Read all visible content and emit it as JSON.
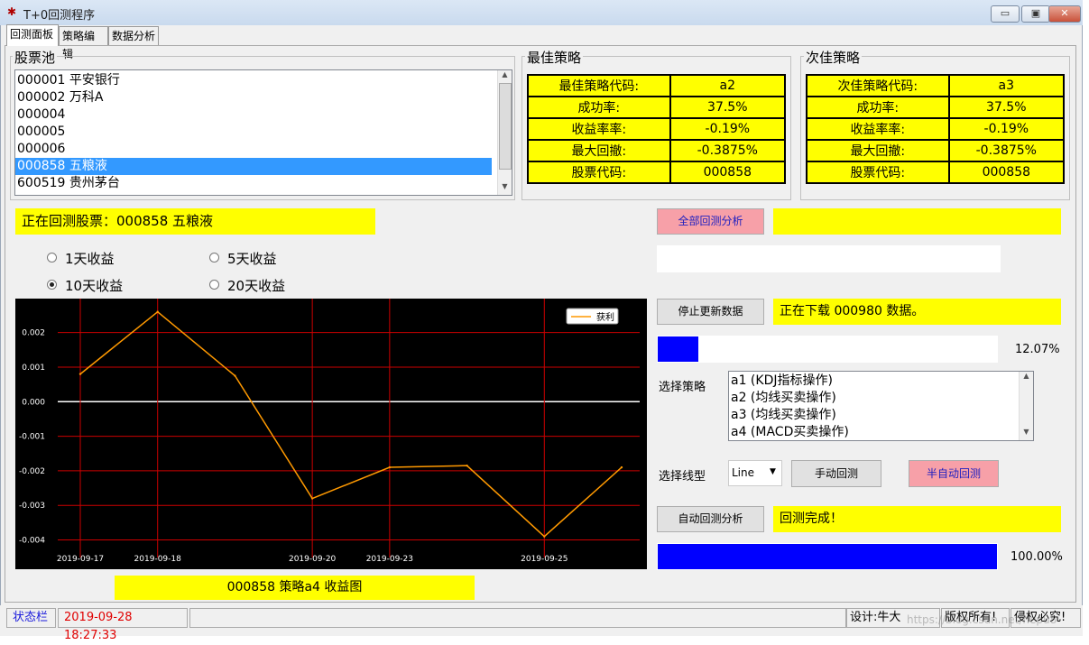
{
  "window": {
    "title": "T+0回测程序",
    "minimize": "▭",
    "maximize": "▣",
    "close": "✕"
  },
  "tabs": [
    "回测面板",
    "策略编辑",
    "数据分析"
  ],
  "stock_pool": {
    "label": "股票池",
    "items": [
      "000001 平安银行",
      "000002 万科A",
      "000004",
      "000005",
      "000006",
      "000858 五粮液",
      "600519 贵州茅台"
    ],
    "selected_index": 5
  },
  "best": {
    "label": "最佳策略",
    "rows": [
      [
        "最佳策略代码:",
        "a2"
      ],
      [
        "成功率:",
        "37.5%"
      ],
      [
        "收益率率:",
        "-0.19%"
      ],
      [
        "最大回撤:",
        "-0.3875%"
      ],
      [
        "股票代码:",
        "000858"
      ]
    ]
  },
  "second": {
    "label": "次佳策略",
    "rows": [
      [
        "次佳策略代码:",
        "a3"
      ],
      [
        "成功率:",
        "37.5%"
      ],
      [
        "收益率率:",
        "-0.19%"
      ],
      [
        "最大回撤:",
        "-0.3875%"
      ],
      [
        "股票代码:",
        "000858"
      ]
    ]
  },
  "current_stock": "正在回测股票：000858 五粮液",
  "horizons": {
    "options": [
      "1天收益",
      "5天收益",
      "10天收益",
      "20天收益"
    ],
    "selected": "10天收益"
  },
  "chart_data": {
    "type": "line",
    "x": [
      "2019-09-17",
      "2019-09-18",
      "2019-09-19",
      "2019-09-20",
      "2019-09-23",
      "2019-09-24",
      "2019-09-25",
      "2019-09-26"
    ],
    "series": [
      {
        "name": "获利",
        "values": [
          0.0008,
          0.0026,
          0.00075,
          -0.0028,
          -0.0019,
          -0.00185,
          -0.0039,
          -0.0019
        ],
        "color": "#ff9900"
      }
    ],
    "x_tick_labels": [
      "2019-09-17",
      "2019-09-18",
      "2019-09-20",
      "2019-09-23",
      "2019-09-25"
    ],
    "y_ticks": [
      0.002,
      0.001,
      0.0,
      -0.001,
      -0.002,
      -0.003,
      -0.004
    ],
    "y_tick_labels": [
      "0.002",
      "0.001",
      "0.000",
      "-0.001",
      "-0.002",
      "-0.003",
      "-0.004"
    ],
    "ylim": [
      -0.0043,
      0.0028
    ],
    "grid": true,
    "legend": "top-right",
    "background": "#000000",
    "grid_color": "#cc0000",
    "zero_line_color": "#ffffff"
  },
  "chart_caption": "000858  策略a4  收益图",
  "buttons": {
    "all_backtest": "全部回测分析",
    "stop_update": "停止更新数据",
    "manual": "手动回测",
    "semi_auto": "半自动回测",
    "auto": "自动回测分析"
  },
  "download": {
    "status": "正在下载 000980 数据。",
    "progress_percent": 12.07,
    "progress_label": "12.07%"
  },
  "strategy_select": {
    "label": "选择策略",
    "items": [
      "a1  (KDJ指标操作)",
      "a2  (均线买卖操作)",
      "a3  (均线买卖操作)",
      "a4  (MACD买卖操作)"
    ]
  },
  "line_type": {
    "label": "选择线型",
    "value": "Line"
  },
  "backtest": {
    "status": "回测完成！",
    "progress_percent": 100,
    "progress_label": "100.00%"
  },
  "statusbar": {
    "label": "状态栏",
    "datetime": "2019-09-28   18:27:33",
    "designer": "设计:牛大",
    "copyright": "版权所有!",
    "infringe": "侵权必究!",
    "watermark": "https://blog.csdn.net/hepu8"
  }
}
